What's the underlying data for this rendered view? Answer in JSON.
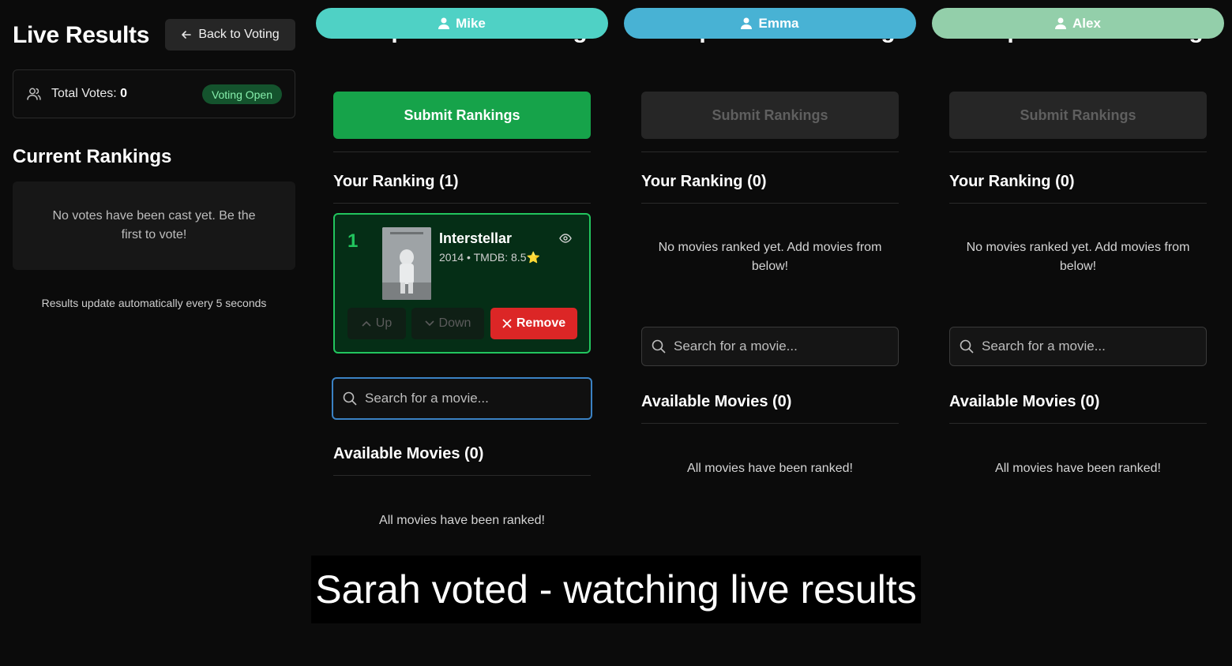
{
  "results": {
    "title": "Live Results",
    "back_label": "Back to Voting",
    "votes_label": "Total Votes:",
    "votes_count": "0",
    "status": "Voting Open",
    "rankings_title": "Current Rankings",
    "empty_text": "No votes have been cast yet. Be the first to vote!",
    "update_note": "Results update automatically every 5 seconds"
  },
  "colors": {
    "mike": "#4fd1c5",
    "emma": "#48b2d4",
    "alex": "#93cfaa",
    "accent_green": "#16a34a"
  },
  "voters": [
    {
      "name": "Mike",
      "hidden_title": "Neospoilers Movie Night",
      "submit_label": "Submit Rankings",
      "ranking_title": "Your Ranking (1)",
      "ranked": [
        {
          "rank": "1",
          "title": "Interstellar",
          "meta": "2014 • TMDB: 8.5⭐",
          "up": "Up",
          "down": "Down",
          "remove": "Remove"
        }
      ],
      "search_placeholder": "Search for a movie...",
      "available_title": "Available Movies (0)",
      "available_empty": "All movies have been ranked!"
    },
    {
      "name": "Emma",
      "hidden_title": "Neospoilers Movie Night",
      "submit_label": "Submit Rankings",
      "ranking_title": "Your Ranking (0)",
      "ranking_empty": "No movies ranked yet. Add movies from below!",
      "search_placeholder": "Search for a movie...",
      "available_title": "Available Movies (0)",
      "available_empty": "All movies have been ranked!"
    },
    {
      "name": "Alex",
      "hidden_title": "Neospoilers Movie Night",
      "submit_label": "Submit Rankings",
      "ranking_title": "Your Ranking (0)",
      "ranking_empty": "No movies ranked yet. Add movies from below!",
      "search_placeholder": "Search for a movie...",
      "available_title": "Available Movies (0)",
      "available_empty": "All movies have been ranked!"
    }
  ],
  "caption": "Sarah voted - watching live results"
}
